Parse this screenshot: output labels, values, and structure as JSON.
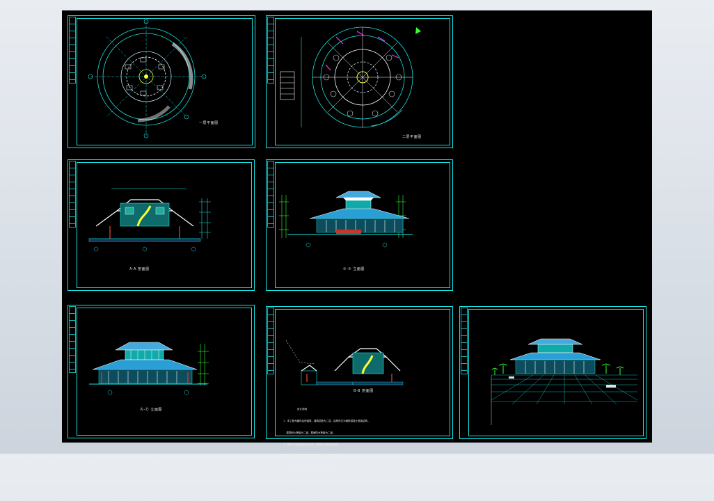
{
  "viewer": {
    "background": "#000000",
    "frame_color": "#19e3e3"
  },
  "sheets": [
    {
      "id": "plan-1",
      "caption": "一层平面图",
      "kind": "floor-plan"
    },
    {
      "id": "plan-2",
      "caption": "二层平面图",
      "kind": "floor-plan"
    },
    {
      "id": "section-a",
      "caption": "A-A 剖面图",
      "kind": "section"
    },
    {
      "id": "elevation-front",
      "caption": "①-⑦ 立面图",
      "kind": "elevation"
    },
    {
      "id": "elevation-side",
      "caption": "Ⓐ-Ⓔ 立面图",
      "kind": "elevation"
    },
    {
      "id": "section-b",
      "caption": "B-B 剖面图",
      "kind": "section"
    },
    {
      "id": "perspective",
      "caption": "",
      "kind": "perspective"
    }
  ],
  "notes": {
    "title": "设计说明",
    "lines": [
      "1.  本工程为圆形会所建筑，建筑层数为二层，结构形式为钢筋混凝土框架结构，",
      "    建筑耐火等级为二级，屋面防水等级为二级。",
      "2.  图中尺寸除标高以米计外，其余均以毫米为单位。",
      "3.  墙体采用轻质砌块，外墙面做法详见立面图所注。",
      "4.  屋面为坡屋面，琉璃瓦屋面，做法详见有关图集。",
      "5.  门窗尺寸详见门窗表，施工时应核对洞口尺寸。",
      "6.  未尽事宜按国家现行有关施工及验收规范执行。"
    ]
  }
}
